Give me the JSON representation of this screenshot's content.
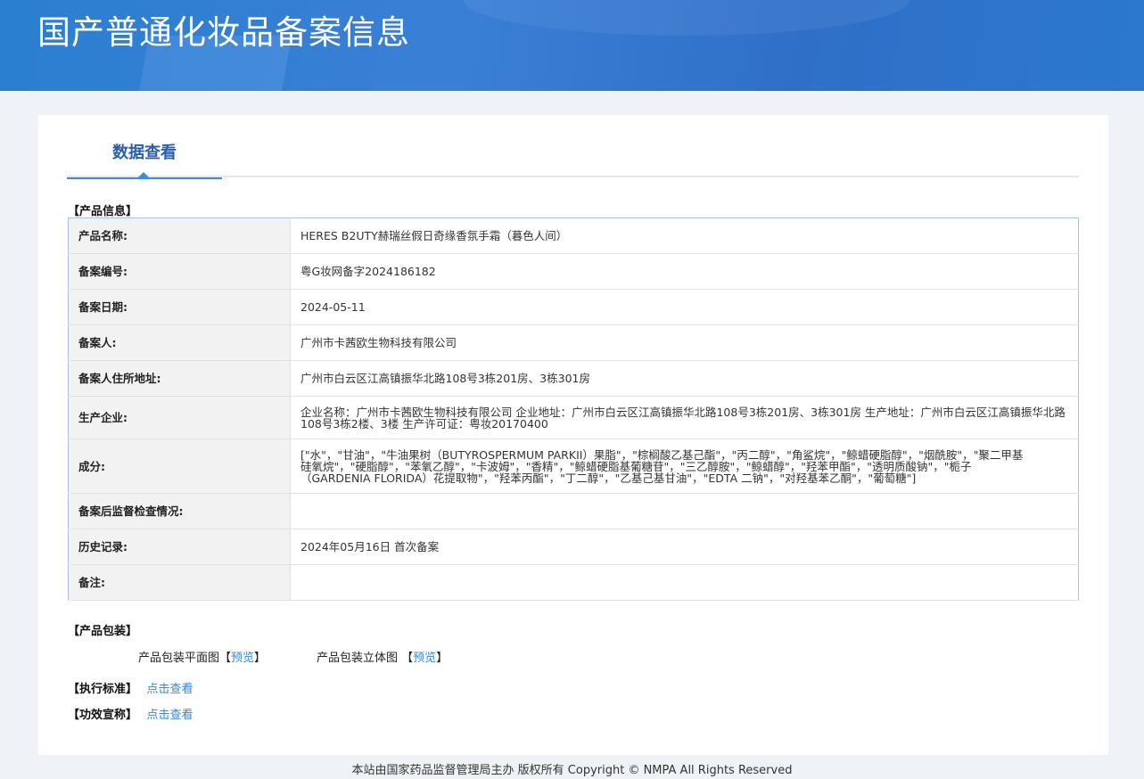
{
  "header": {
    "title": "国产普通化妆品备案信息"
  },
  "tabs": [
    {
      "label": "数据查看"
    }
  ],
  "product_info": {
    "section_title": "【产品信息】",
    "rows": [
      {
        "label": "产品名称:",
        "value": "HERES B2UTY赫瑞丝假日奇缘香氛手霜（暮色人间）"
      },
      {
        "label": "备案编号:",
        "value": "粤G妆网备字2024186182"
      },
      {
        "label": "备案日期:",
        "value": "2024-05-11"
      },
      {
        "label": "备案人:",
        "value": "广州市卡茜欧生物科技有限公司"
      },
      {
        "label": "备案人住所地址:",
        "value": "广州市白云区江高镇振华北路108号3栋201房、3栋301房"
      },
      {
        "label": "生产企业:",
        "value": "企业名称：广州市卡茜欧生物科技有限公司 企业地址：广州市白云区江高镇振华北路108号3栋201房、3栋301房 生产地址：广州市白云区江高镇振华北路108号3栋2楼、3楼 生产许可证：粤妆20170400"
      },
      {
        "label": "成分:",
        "value": "[\"水\"，\"甘油\"，\"牛油果树（BUTYROSPERMUM PARKII）果脂\"，\"棕榈酸乙基己酯\"，\"丙二醇\"，\"角鲨烷\"，\"鲸蜡硬脂醇\"，\"烟酰胺\"，\"聚二甲基硅氧烷\"，\"硬脂醇\"，\"苯氧乙醇\"，\"卡波姆\"，\"香精\"，\"鲸蜡硬脂基葡糖苷\"，\"三乙醇胺\"，\"鲸蜡醇\"，\"羟苯甲酯\"，\"透明质酸钠\"，\"栀子（GARDENIA FLORIDA）花提取物\"，\"羟苯丙酯\"，\"丁二醇\"，\"乙基己基甘油\"，\"EDTA 二钠\"，\"对羟基苯乙酮\"，\"葡萄糖\"]"
      },
      {
        "label": "备案后监督检查情况:",
        "value": ""
      },
      {
        "label": "历史记录:",
        "value": "2024年05月16日 首次备案"
      },
      {
        "label": "备注:",
        "value": ""
      }
    ]
  },
  "packaging": {
    "section_title": "【产品包装】",
    "flat_label": "产品包装平面图",
    "stereo_label": "产品包装立体图",
    "bracket_open": "【",
    "bracket_close": "】",
    "preview": "预览"
  },
  "standard": {
    "label": "【执行标准】",
    "link": "点击查看"
  },
  "efficacy": {
    "label": "【功效宣称】",
    "link": "点击查看"
  },
  "footer": {
    "text": "本站由国家药品监督管理局主办 版权所有 Copyright © NMPA All Rights Reserved"
  }
}
